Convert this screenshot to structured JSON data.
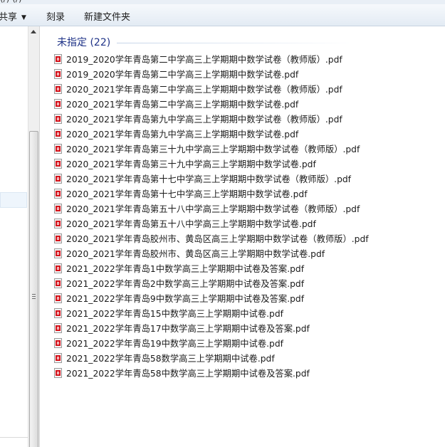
{
  "window": {
    "title_fragment": "(/)  (/)"
  },
  "toolbar": {
    "share_label": "共享",
    "burn_label": "刻录",
    "new_folder_label": "新建文件夹"
  },
  "group": {
    "header": "未指定 (22)"
  },
  "files": [
    "2019_2020学年青岛第二中学高三上学期期中数学试卷（教师版）.pdf",
    "2019_2020学年青岛第二中学高三上学期期中数学试卷.pdf",
    "2020_2021学年青岛第二中学高三上学期期中数学试卷（教师版）.pdf",
    "2020_2021学年青岛第二中学高三上学期期中数学试卷.pdf",
    "2020_2021学年青岛第九中学高三上学期期中数学试卷（教师版）.pdf",
    "2020_2021学年青岛第九中学高三上学期期中数学试卷.pdf",
    "2020_2021学年青岛第三十九中学高三上学期期中数学试卷（教师版）.pdf",
    "2020_2021学年青岛第三十九中学高三上学期期中数学试卷.pdf",
    "2020_2021学年青岛第十七中学高三上学期期中数学试卷（教师版）.pdf",
    "2020_2021学年青岛第十七中学高三上学期期中数学试卷.pdf",
    "2020_2021学年青岛第五十八中学高三上学期期中数学试卷（教师版）.pdf",
    "2020_2021学年青岛第五十八中学高三上学期期中数学试卷.pdf",
    "2020_2021学年青岛胶州市、黄岛区高三上学期期中数学试卷（教师版）.pdf",
    "2020_2021学年青岛胶州市、黄岛区高三上学期期中数学试卷.pdf",
    "2021_2022学年青岛1中数学高三上学期期中试卷及答案.pdf",
    "2021_2022学年青岛2中数学高三上学期期中试卷及答案.pdf",
    "2021_2022学年青岛9中数学高三上学期期中试卷及答案.pdf",
    "2021_2022学年青岛15中数学高三上学期期中试卷.pdf",
    "2021_2022学年青岛17中数学高三上学期期中试卷及答案.pdf",
    "2021_2022学年青岛19中数学高三上学期期中试卷.pdf",
    "2021_2022学年青岛58数学高三上学期期中试卷.pdf",
    "2021_2022学年青岛58中数学高三上学期期中试卷及答案.pdf"
  ],
  "icons": {
    "file_icon": "pdf-file-icon",
    "share_dropdown": "dropdown-arrow-icon",
    "scroll_up": "scroll-up-arrow-icon",
    "scroll_grip": "scroll-grip-icon"
  },
  "colors": {
    "group_header": "#1e3287",
    "pdf_icon": "#d4121b",
    "toolbar_top": "#f6f9fc",
    "toolbar_bottom": "#e3ebf4"
  }
}
